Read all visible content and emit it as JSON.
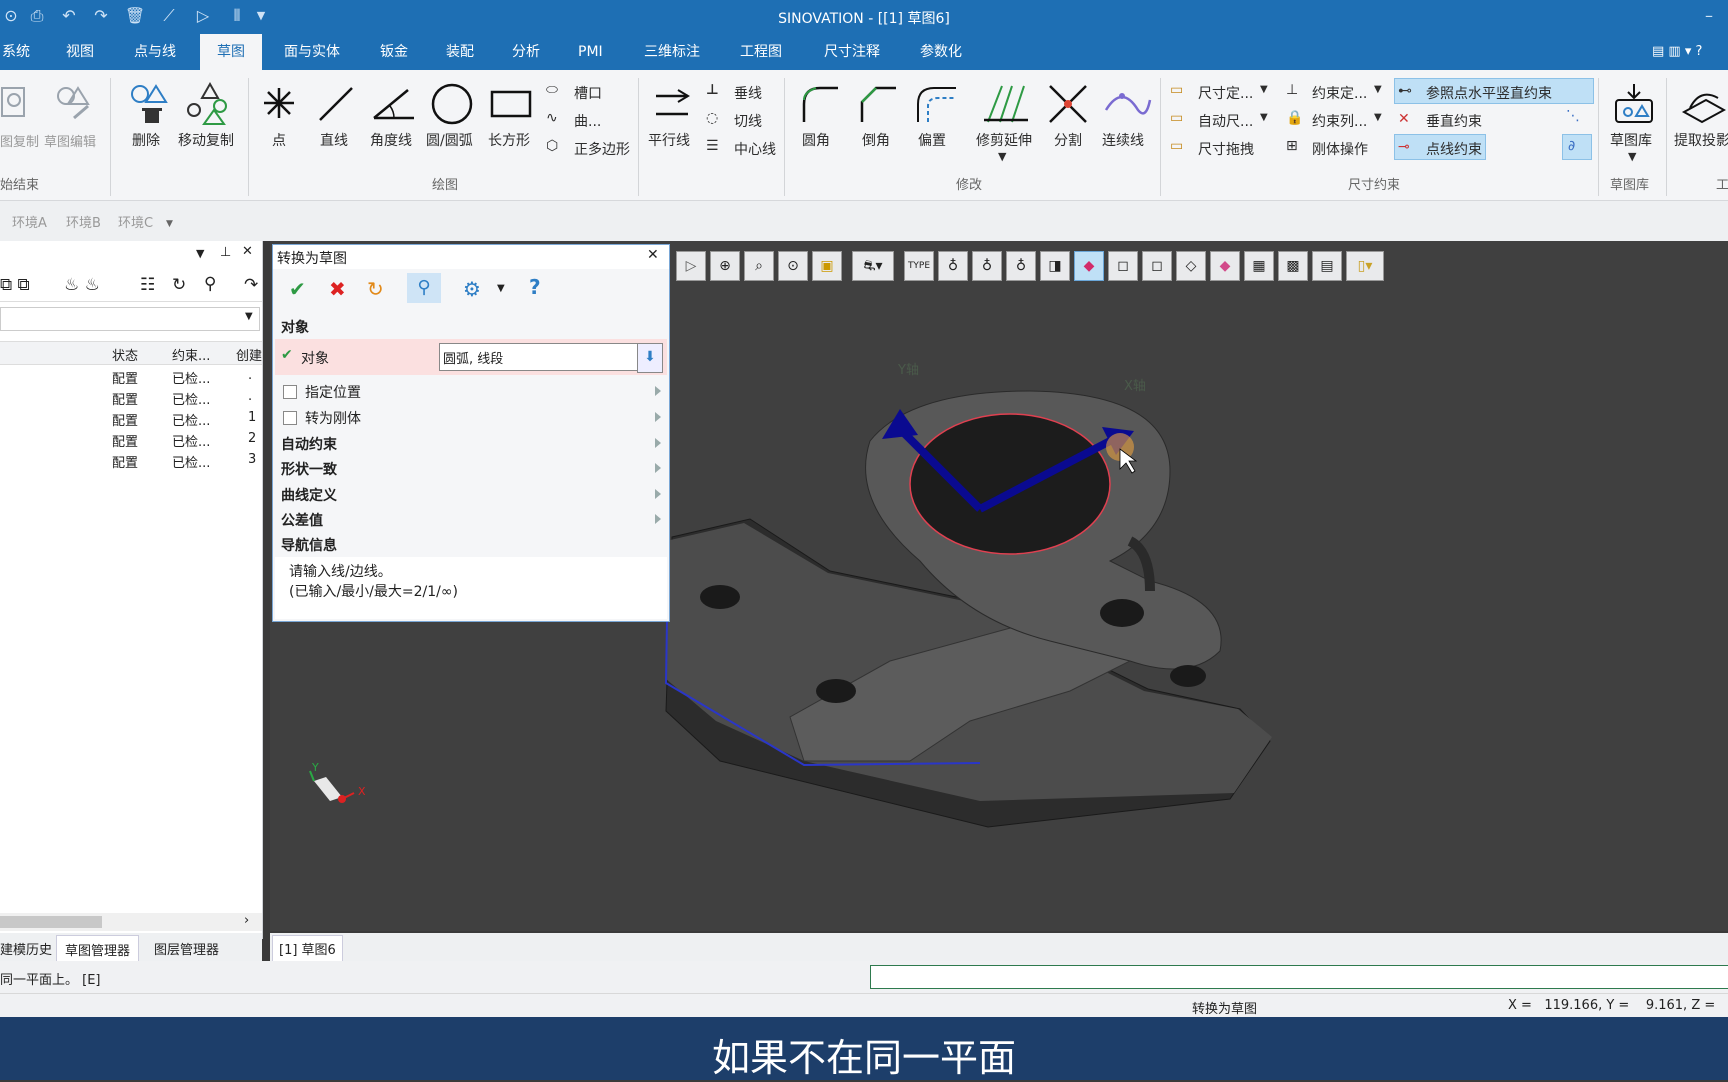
{
  "window": {
    "title": "SINOVATION - [[1] 草图6]",
    "minimize": "–"
  },
  "menu": [
    "系统",
    "视图",
    "点与线",
    "草图",
    "面与实体",
    "钣金",
    "装配",
    "分析",
    "PMI",
    "三维标注",
    "工程图",
    "尺寸注释",
    "参数化"
  ],
  "menu_active": "草图",
  "ribbon": {
    "copy": "图复制",
    "sketch_edit": "草图编辑",
    "delete": "删除",
    "move_copy": "移动复制",
    "point": "点",
    "line": "直线",
    "angle_line": "角度线",
    "circle_arc": "圆/圆弧",
    "rect": "长方形",
    "slot": "槽口",
    "curve": "曲...",
    "polygon": "正多边形",
    "parallel": "平行线",
    "perpendicular": "垂线",
    "tangent": "切线",
    "centerline": "中心线",
    "fillet": "圆角",
    "chamfer": "倒角",
    "offset": "偏置",
    "trim_extend": "修剪延伸",
    "split": "分割",
    "connect": "连续线",
    "dim_def": "尺寸定...",
    "auto_dim": "自动尺...",
    "dim_drag": "尺寸拖拽",
    "cons_def": "约束定...",
    "cons_list": "约束列...",
    "rigid_op": "刚体操作",
    "ref_hv": "参照点水平竖直约束",
    "perp_cons": "垂直约束",
    "pt_line_cons": "点线约束",
    "sketch_lib": "草图库",
    "extract": "提取投影",
    "groups": {
      "end": "始结束",
      "draw": "绘图",
      "modify": "修改",
      "dim_cons": "尺寸约束",
      "lib": "草图库",
      "tool": "工"
    }
  },
  "env": [
    "环境A",
    "环境B",
    "环境C"
  ],
  "left_panel": {
    "headers": [
      "状态",
      "约束...",
      "创建"
    ],
    "rows": [
      [
        "配置",
        "已检...",
        "."
      ],
      [
        "配置",
        "已检...",
        "."
      ],
      [
        "配置",
        "已检...",
        "1"
      ],
      [
        "配置",
        "已检...",
        "2"
      ],
      [
        "配置",
        "已检...",
        "3"
      ]
    ],
    "tabs": [
      "建模历史",
      "草图管理器",
      "图层管理器"
    ]
  },
  "dialog": {
    "title": "转换为草图",
    "section_object": "对象",
    "object_label": "对象",
    "object_value": "圆弧, 线段",
    "opt_position": "指定位置",
    "opt_rigid": "转为刚体",
    "auto_cons": "自动约束",
    "shape": "形状一致",
    "curve_def": "曲线定义",
    "tolerance": "公差值",
    "nav": "导航信息",
    "nav_line1": "请输入线/边线。",
    "nav_line2": "(已输入/最小/最大=2/1/∞)"
  },
  "viewport": {
    "tab": "[1] 草图6",
    "x_axis": "X轴",
    "y_axis": "Y轴",
    "triad_y": "Y",
    "triad_x": "X"
  },
  "command_line": "同一平面上。 [E]",
  "status": {
    "mode": "转换为草图",
    "coords": "X =   119.166, Y =    9.161, Z ="
  },
  "subtitle": "如果不在同一平面",
  "colors": {
    "accent": "#1e6fb4",
    "subtitle_bg": "#1d3e6a",
    "viewport_bg": "#404040",
    "highlight": "#bfe0f6"
  }
}
